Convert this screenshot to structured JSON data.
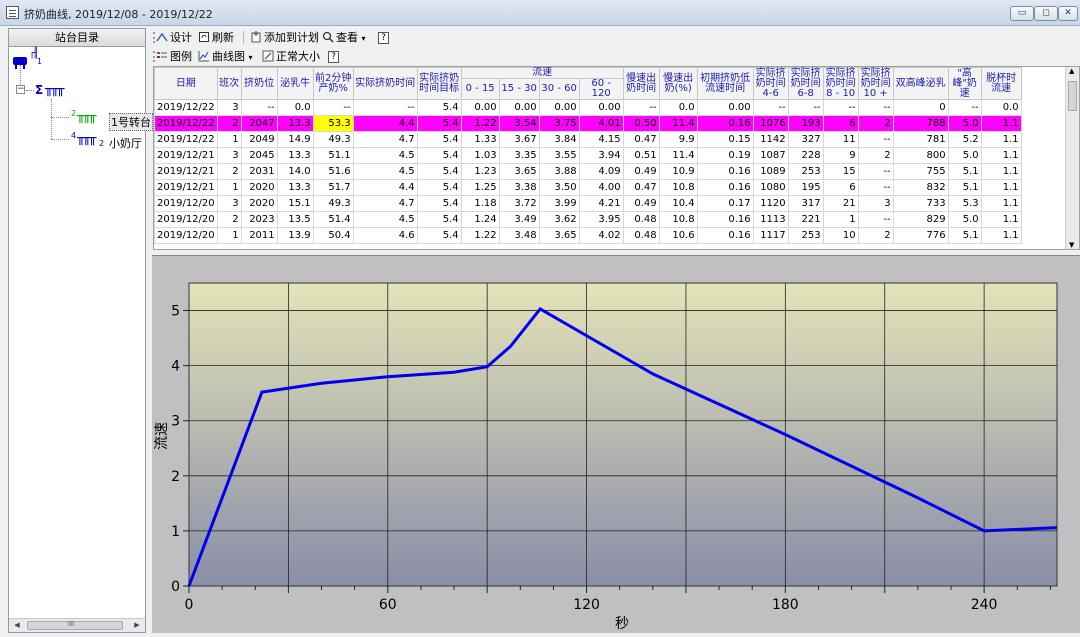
{
  "window": {
    "title": "挤奶曲线, 2019/12/08 - 2019/12/22"
  },
  "left_panel": {
    "header": "站台目录",
    "tree": {
      "root_label": "1",
      "sum_label": "Σ",
      "node1_num": "2",
      "node1_label": "1号转台",
      "node2_num": "4",
      "node2_sub": "2",
      "node2_label": "小奶厅"
    },
    "scroll_label": "III"
  },
  "toolbar1": {
    "design": "设计",
    "refresh": "刷新",
    "add_plan": "添加到计划",
    "view": "查看",
    "help": "?"
  },
  "toolbar2": {
    "legend": "图例",
    "curve": "曲线图",
    "normal_size": "正常大小",
    "help": "?"
  },
  "table": {
    "flow_group": "流速",
    "sort_date": "▽1",
    "sort_shift": "▽2",
    "headers": [
      "日期",
      "班次",
      "挤奶位",
      "泌乳牛",
      "前2分钟产奶%",
      "实际挤奶时间",
      "实际挤奶时间目标",
      "0 - 15",
      "15 - 30",
      "30 - 60",
      "60 - 120",
      "慢速出奶时间",
      "慢速出奶(%)",
      "初期挤奶低流速时间",
      "实际挤奶时间4-6",
      "实际挤奶时间6-8",
      "实际挤奶时间8 - 10",
      "实际挤奶时间10 +",
      "双高峰泌乳",
      "\"高峰\"奶速",
      "脱杯时流速"
    ],
    "rows": [
      [
        "2019/12/22",
        "3",
        "--",
        "0.0",
        "--",
        "--",
        "5.4",
        "0.00",
        "0.00",
        "0.00",
        "0.00",
        "--",
        "0.0",
        "0.00",
        "--",
        "--",
        "--",
        "--",
        "0",
        "--",
        "0.0"
      ],
      [
        "2019/12/22",
        "2",
        "2047",
        "13.3",
        "53.3",
        "4.4",
        "5.4",
        "1.22",
        "3.54",
        "3.75",
        "4.01",
        "0.50",
        "11.4",
        "0.16",
        "1076",
        "193",
        "6",
        "2",
        "788",
        "5.0",
        "1.1"
      ],
      [
        "2019/12/22",
        "1",
        "2049",
        "14.9",
        "49.3",
        "4.7",
        "5.4",
        "1.33",
        "3.67",
        "3.84",
        "4.15",
        "0.47",
        "9.9",
        "0.15",
        "1142",
        "327",
        "11",
        "--",
        "781",
        "5.2",
        "1.1"
      ],
      [
        "2019/12/21",
        "3",
        "2045",
        "13.3",
        "51.1",
        "4.5",
        "5.4",
        "1.03",
        "3.35",
        "3.55",
        "3.94",
        "0.51",
        "11.4",
        "0.19",
        "1087",
        "228",
        "9",
        "2",
        "800",
        "5.0",
        "1.1"
      ],
      [
        "2019/12/21",
        "2",
        "2031",
        "14.0",
        "51.6",
        "4.5",
        "5.4",
        "1.23",
        "3.65",
        "3.88",
        "4.09",
        "0.49",
        "10.9",
        "0.16",
        "1089",
        "253",
        "15",
        "--",
        "755",
        "5.1",
        "1.1"
      ],
      [
        "2019/12/21",
        "1",
        "2020",
        "13.3",
        "51.7",
        "4.4",
        "5.4",
        "1.25",
        "3.38",
        "3.50",
        "4.00",
        "0.47",
        "10.8",
        "0.16",
        "1080",
        "195",
        "6",
        "--",
        "832",
        "5.1",
        "1.1"
      ],
      [
        "2019/12/20",
        "3",
        "2020",
        "15.1",
        "49.3",
        "4.7",
        "5.4",
        "1.18",
        "3.72",
        "3.99",
        "4.21",
        "0.49",
        "10.4",
        "0.17",
        "1120",
        "317",
        "21",
        "3",
        "733",
        "5.3",
        "1.1"
      ],
      [
        "2019/12/20",
        "2",
        "2023",
        "13.5",
        "51.4",
        "4.5",
        "5.4",
        "1.24",
        "3.49",
        "3.62",
        "3.95",
        "0.48",
        "10.8",
        "0.16",
        "1113",
        "221",
        "1",
        "--",
        "829",
        "5.0",
        "1.1"
      ],
      [
        "2019/12/20",
        "1",
        "2011",
        "13.9",
        "50.4",
        "4.6",
        "5.4",
        "1.22",
        "3.48",
        "3.65",
        "4.02",
        "0.48",
        "10.6",
        "0.16",
        "1117",
        "253",
        "10",
        "2",
        "776",
        "5.1",
        "1.1"
      ]
    ],
    "selected_row": 1,
    "highlight_color": "#ff00ff",
    "yellow_color": "#ffff00"
  },
  "chart_data": {
    "type": "line",
    "xlabel": "秒",
    "ylabel": "流速",
    "xlim": [
      0,
      262
    ],
    "ylim": [
      0,
      5.5
    ],
    "xticks": [
      0,
      60,
      120,
      180,
      240
    ],
    "yticks": [
      0,
      1,
      2,
      3,
      4,
      5
    ],
    "grid": true,
    "line_color": "#0000ee",
    "x": [
      0,
      22,
      40,
      60,
      80,
      90,
      97,
      106,
      140,
      180,
      220,
      240,
      262
    ],
    "y": [
      0,
      3.52,
      3.68,
      3.8,
      3.88,
      3.98,
      4.35,
      5.03,
      3.85,
      2.75,
      1.6,
      1.0,
      1.06
    ]
  }
}
